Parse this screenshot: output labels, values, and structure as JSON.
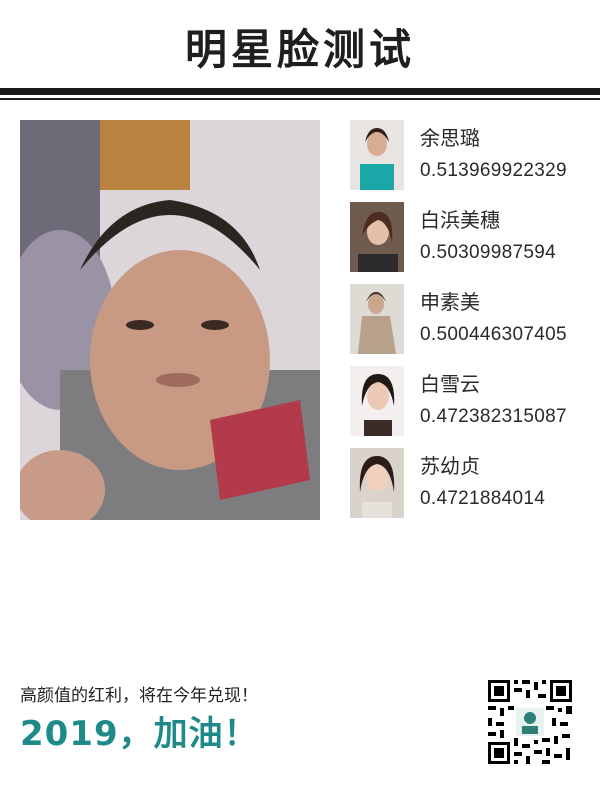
{
  "header": {
    "title": "明星脸测试"
  },
  "matches": [
    {
      "name": "余思璐",
      "score": "0.513969922329"
    },
    {
      "name": "白浜美穗",
      "score": "0.50309987594"
    },
    {
      "name": "申素美",
      "score": "0.500446307405"
    },
    {
      "name": "白雪云",
      "score": "0.472382315087"
    },
    {
      "name": "苏幼贞",
      "score": "0.4721884014"
    }
  ],
  "footer": {
    "slogan": "高颜值的红利，将在今年兑现！",
    "cheer": "2019，加油！"
  },
  "colors": {
    "accent": "#1f8a8a",
    "rule": "#1b1b1b"
  }
}
